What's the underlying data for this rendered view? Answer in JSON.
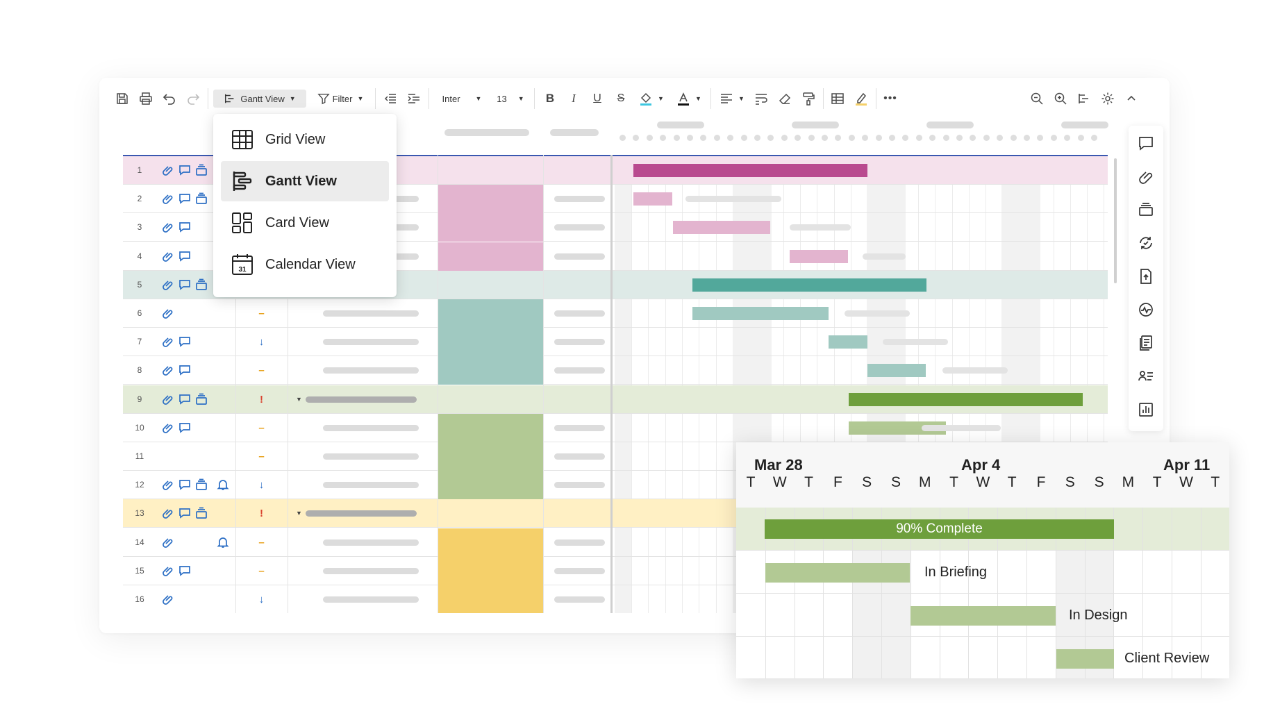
{
  "toolbar": {
    "view_label": "Gantt View",
    "filter_label": "Filter",
    "font_label": "Inter",
    "size_label": "13"
  },
  "menu": {
    "items": [
      {
        "label": "Grid View",
        "icon": "grid-icon"
      },
      {
        "label": "Gantt View",
        "icon": "gantt-icon",
        "active": true
      },
      {
        "label": "Card View",
        "icon": "card-icon"
      },
      {
        "label": "Calendar View",
        "icon": "calendar-icon",
        "badge": "31"
      }
    ]
  },
  "rows": [
    {
      "num": "1"
    },
    {
      "num": "2"
    },
    {
      "num": "3"
    },
    {
      "num": "4"
    },
    {
      "num": "5"
    },
    {
      "num": "6",
      "flag": "–"
    },
    {
      "num": "7",
      "flag": "↓"
    },
    {
      "num": "8",
      "flag": "–"
    },
    {
      "num": "9",
      "flag": "!"
    },
    {
      "num": "10",
      "flag": "–"
    },
    {
      "num": "11",
      "flag": "–"
    },
    {
      "num": "12",
      "flag": "↓"
    },
    {
      "num": "13",
      "flag": "!"
    },
    {
      "num": "14",
      "flag": "–"
    },
    {
      "num": "15",
      "flag": "–"
    },
    {
      "num": "16",
      "flag": "↓"
    }
  ],
  "zoom": {
    "months": [
      "Mar 28",
      "Apr 4",
      "Apr 11"
    ],
    "days": [
      "T",
      "W",
      "T",
      "F",
      "S",
      "S",
      "M",
      "T",
      "W",
      "T",
      "F",
      "S",
      "S",
      "M",
      "T",
      "W",
      "T"
    ],
    "bars": [
      {
        "label": "90% Complete"
      },
      {
        "label": "In Briefing"
      },
      {
        "label": "In Design"
      },
      {
        "label": "Client Review"
      }
    ]
  },
  "colors": {
    "pink_dark": "#b94a8f",
    "pink_light": "#e3b4cf",
    "pink_bg": "#f5e1ec",
    "teal_dark": "#52a89b",
    "teal_light": "#a0c9c1",
    "teal_bg": "#deeae7",
    "green_dark": "#6e9f3c",
    "green_light": "#b2c994",
    "green_bg": "#e4ecd8",
    "yellow_bg": "#fff0c4",
    "yellow": "#f5d06a",
    "accent_blue": "#3a57b0",
    "icon_blue": "#2c6fc5",
    "flag_orange": "#e8a21c",
    "flag_red": "#d9432f"
  }
}
